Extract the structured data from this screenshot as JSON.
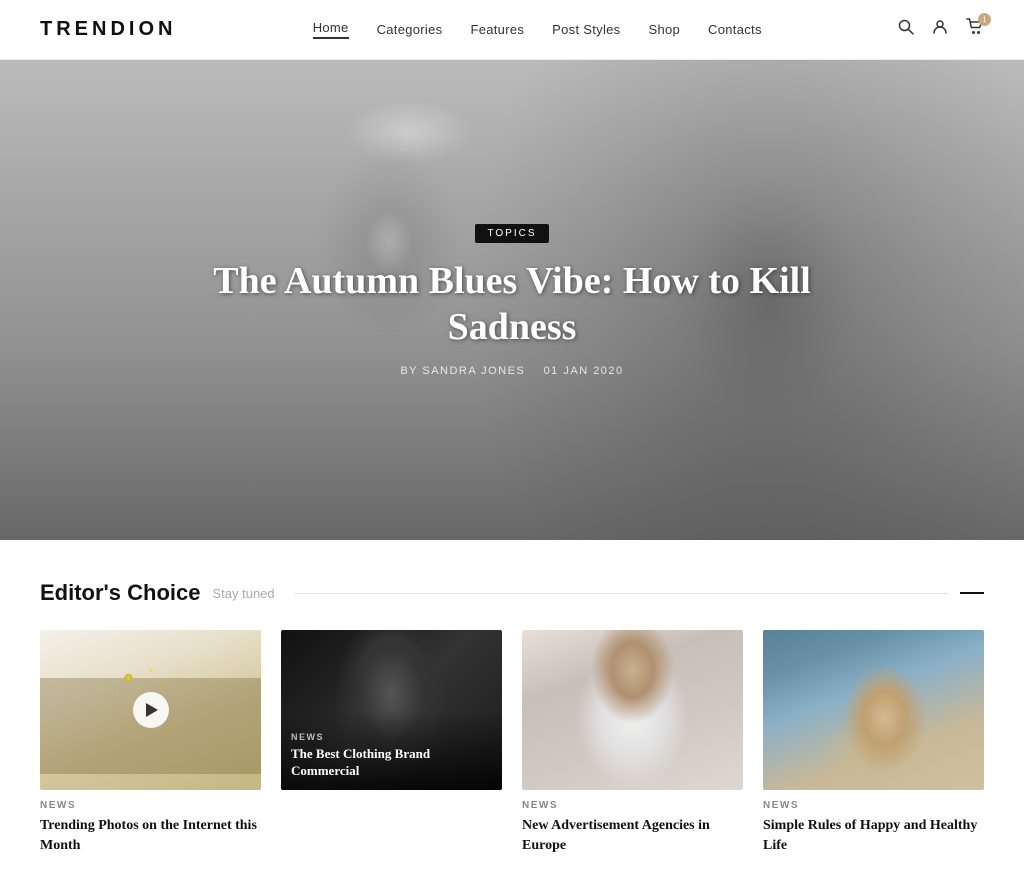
{
  "header": {
    "logo": "TRENDION",
    "nav": [
      {
        "label": "Home",
        "active": true
      },
      {
        "label": "Categories",
        "active": false
      },
      {
        "label": "Features",
        "active": false
      },
      {
        "label": "Post Styles",
        "active": false
      },
      {
        "label": "Shop",
        "active": false
      },
      {
        "label": "Contacts",
        "active": false
      }
    ],
    "cart_count": "1"
  },
  "hero": {
    "badge": "TOPICS",
    "title": "The Autumn Blues Vibe: How to Kill Sadness",
    "author": "BY SANDRA JONES",
    "date": "01 JAN 2020"
  },
  "editors_choice": {
    "title": "Editor's Choice",
    "subtitle": "Stay tuned",
    "cards": [
      {
        "category": "NEWS",
        "title": "Trending Photos on the Internet this Month",
        "has_play": true,
        "has_overlay": false
      },
      {
        "category": "NEWS",
        "title": "The Best Clothing Brand Commercial",
        "has_play": false,
        "has_overlay": true
      },
      {
        "category": "NEWS",
        "title": "New Advertisement Agencies in Europe",
        "has_play": false,
        "has_overlay": false
      },
      {
        "category": "NEWS",
        "title": "Simple Rules of Happy and Healthy Life",
        "has_play": false,
        "has_overlay": false
      }
    ]
  }
}
